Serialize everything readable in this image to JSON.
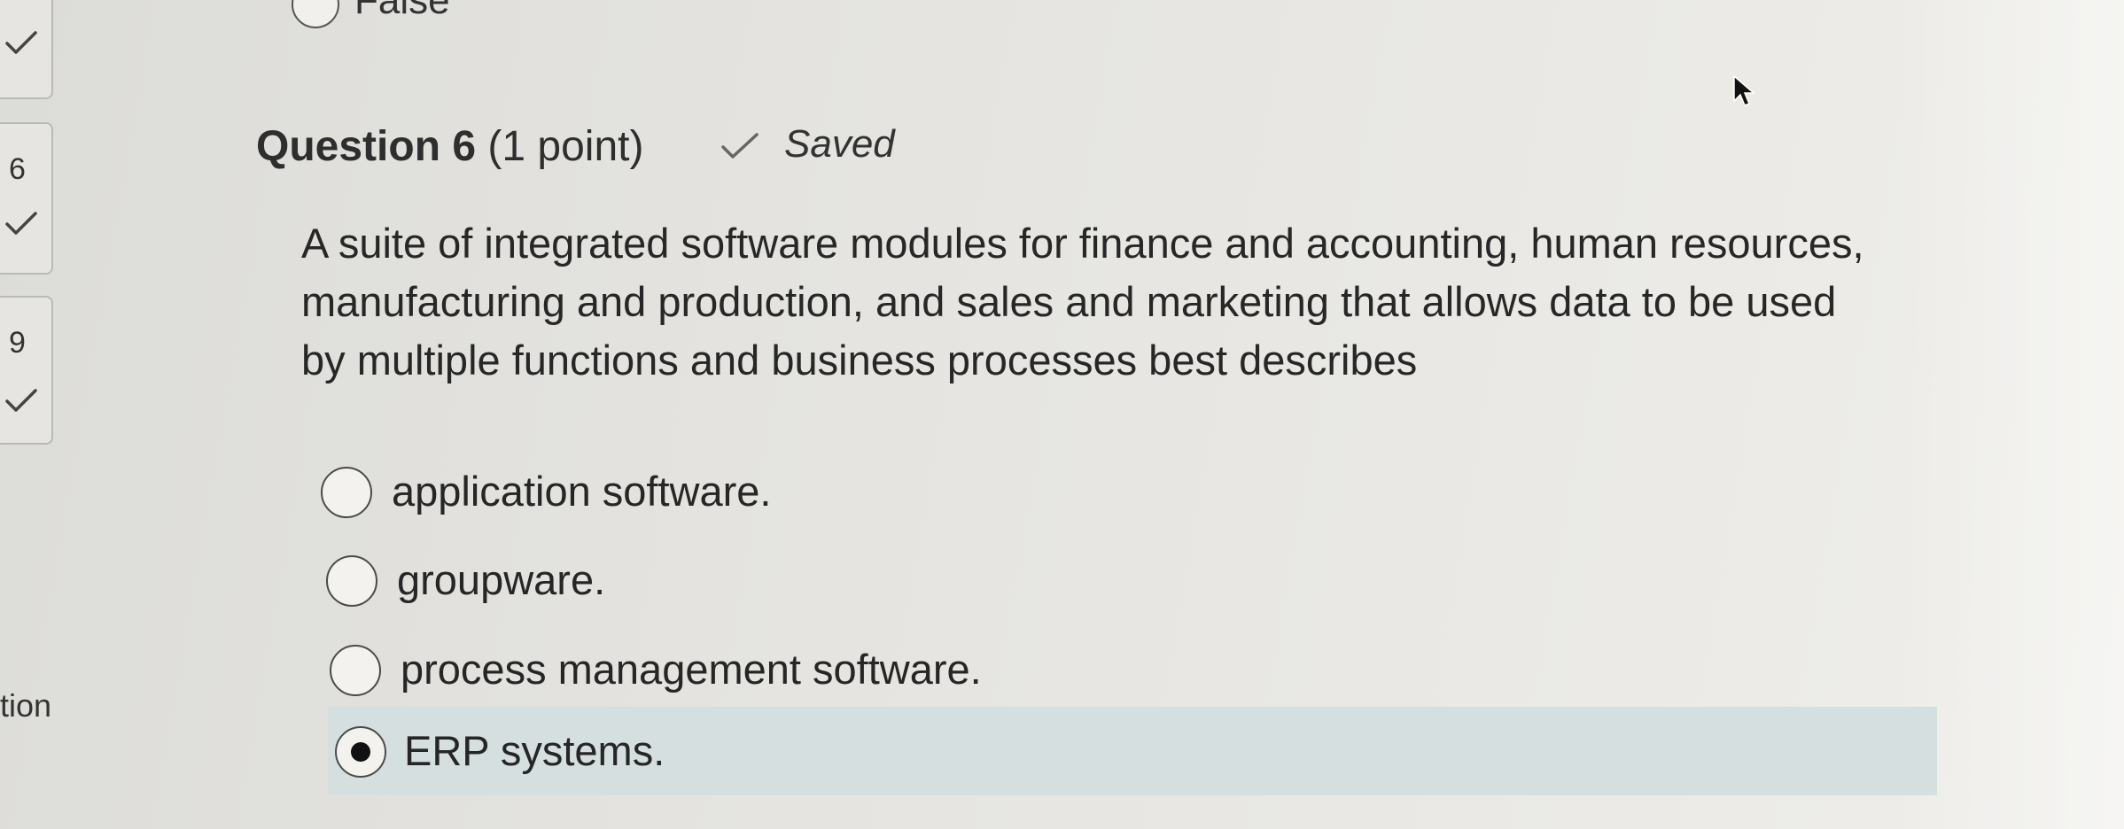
{
  "navigator": {
    "items": [
      {
        "number": "",
        "status": "answered"
      },
      {
        "number": "6",
        "status": "answered"
      },
      {
        "number": "9",
        "status": "answered"
      }
    ],
    "partial_label": "tion"
  },
  "previous_question": {
    "option_label": "False"
  },
  "question": {
    "title": "Question 6",
    "points": "(1 point)",
    "saved_status": "Saved",
    "text_lines": [
      "A suite of integrated software modules for finance and accounting, human resources,",
      "manufacturing and production, and sales and marketing that allows data to be used",
      "by multiple functions and business processes best describes"
    ],
    "options": [
      {
        "label": "application software.",
        "selected": false
      },
      {
        "label": "groupware.",
        "selected": false
      },
      {
        "label": "process management software.",
        "selected": false
      },
      {
        "label": "ERP systems.",
        "selected": true
      }
    ]
  },
  "icons": {
    "check": "checkmark-icon",
    "cursor": "mouse-pointer-icon"
  },
  "colors": {
    "selected_row": "#d5dfdf",
    "radio_border": "#4a4a4a"
  }
}
